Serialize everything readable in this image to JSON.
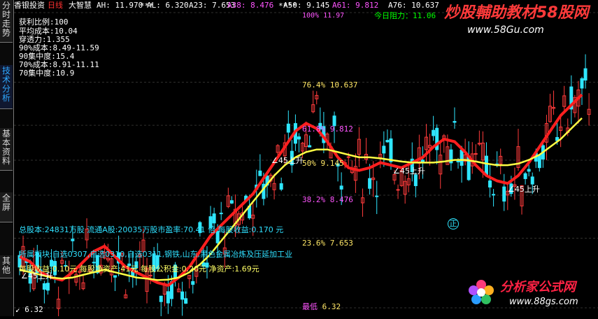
{
  "side_tabs": [
    {
      "label": "分时走势",
      "active": false
    },
    {
      "label": "技术分析",
      "active": true
    },
    {
      "label": "基本资料",
      "active": false
    },
    {
      "label": "全屏",
      "active": false
    },
    {
      "label": "其他",
      "active": false
    }
  ],
  "header": {
    "stock_name": "香银投资",
    "period": "日线",
    "indicator": "大智慧",
    "items": [
      {
        "k": "AH:",
        "v": "11.970",
        "c": "#ffffff"
      },
      {
        "k": "AL:",
        "v": "6.320",
        "c": "#ffffff"
      },
      {
        "k": "A23:",
        "v": "7.653",
        "c": "#ffffff"
      },
      {
        "k": "A38:",
        "v": "8.476",
        "c": "#ff55ff"
      },
      {
        "k": "A50:",
        "v": "9.145",
        "c": "#ffffff"
      },
      {
        "k": "A61:",
        "v": "9.812",
        "c": "#ff55ff"
      },
      {
        "k": "A76:",
        "v": "10.637",
        "c": "#ffffff"
      }
    ],
    "stars": [
      "***",
      "****"
    ],
    "top_fib": "100%  11.97",
    "today_resistance": "今日阻力：11.06"
  },
  "left_panel": [
    {
      "text": "获利比例:100",
      "c": "#ffffff"
    },
    {
      "text": "平均成本:10.04",
      "c": "#ffffff"
    },
    {
      "text": "穿透力:1.355",
      "c": "#ffffff"
    },
    {
      "text": "90%成本:8.49-11.59",
      "c": "#ffffff",
      "tag": "90",
      "tc": "#ffe766"
    },
    {
      "text": "90集中度:15.4",
      "c": "#ffffff",
      "tag": "",
      "tc": "#ffe766"
    },
    {
      "text": "70%成本:8.91-11.11",
      "c": "#ffffff",
      "tag": "70",
      "tc": "#ffe766"
    },
    {
      "text": "70集中度:10.9",
      "c": "#ffffff",
      "tag": "",
      "tc": "#ffe766"
    }
  ],
  "fib_levels": [
    {
      "pct": "76.4%",
      "val": "10.637"
    },
    {
      "pct": "61.8%",
      "val": "9.812"
    },
    {
      "pct": "50%",
      "val": "9.145"
    },
    {
      "pct": "38.2%",
      "val": "8.476"
    },
    {
      "pct": "23.6%",
      "val": "7.653"
    },
    {
      "pct": "最低",
      "val": "6.32"
    }
  ],
  "annotations": [
    {
      "text": "∠45上升"
    },
    {
      "text": "∠45上升"
    },
    {
      "text": "∠45上升"
    },
    {
      "text": "∠45上升"
    }
  ],
  "marker": "正",
  "low_mark": "6.32",
  "info_lines": [
    "总股本:24831万股  流通A股:20035万股市盈率:70.41 倍    每股收益:0.170 元",
    "所属板块:自选0307,自选0310,自选0311,钢铁,山东,黑色金属冶炼及压延加工业",
    "每股收益:0.10元  每股净资产:41元  每股公积金:0.20元  净资产:1.69元"
  ],
  "watermarks": {
    "top_logo": "炒股輔助教材58股网",
    "top_url": "www.58Gu.com",
    "bottom_logo": "分析家公式网",
    "bottom_url": "www.88gs.com"
  },
  "chart_data": {
    "type": "line",
    "ylim": [
      6.32,
      11.97
    ],
    "series": [
      {
        "name": "",
        "values": [
          7.3,
          7.2,
          7.0,
          6.9,
          6.85,
          7.0,
          7.2,
          7.4,
          7.5,
          7.3,
          7.1,
          7.0,
          6.9,
          6.8,
          6.75,
          6.9,
          7.1,
          7.4,
          7.7,
          7.9,
          8.1,
          8.3,
          8.5,
          8.8,
          9.1,
          9.4,
          9.7,
          9.85,
          9.75,
          9.5,
          9.2,
          9.0,
          8.95,
          9.0,
          9.1,
          9.05,
          9.0,
          9.1,
          9.2,
          9.4,
          9.55,
          9.5,
          9.3,
          9.05,
          8.85,
          8.75,
          8.7,
          8.85,
          9.1,
          9.4,
          9.7,
          10.0,
          10.2,
          10.4
        ]
      },
      {
        "name": "",
        "values": [
          7.05,
          7.0,
          6.95,
          6.9,
          6.88,
          6.9,
          6.95,
          7.0,
          7.05,
          7.0,
          6.95,
          6.9,
          6.88,
          6.85,
          6.86,
          6.9,
          7.0,
          7.15,
          7.35,
          7.6,
          7.85,
          8.1,
          8.35,
          8.6,
          8.85,
          9.05,
          9.2,
          9.3,
          9.35,
          9.35,
          9.3,
          9.25,
          9.2,
          9.2,
          9.18,
          9.15,
          9.12,
          9.1,
          9.1,
          9.1,
          9.12,
          9.15,
          9.15,
          9.12,
          9.08,
          9.05,
          9.05,
          9.08,
          9.15,
          9.25,
          9.4,
          9.55,
          9.75,
          9.95
        ]
      }
    ]
  }
}
